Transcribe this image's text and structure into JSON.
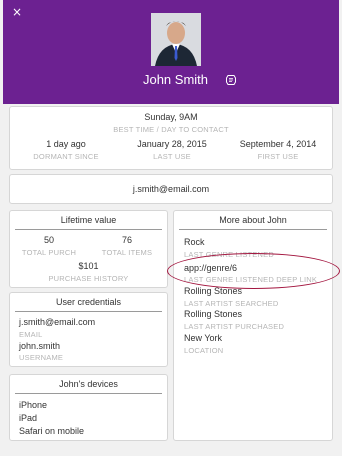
{
  "header": {
    "close_glyph": "×",
    "name": "John Smith",
    "bg_color": "#6c2191"
  },
  "contact": {
    "best_time_value": "Sunday, 9AM",
    "best_time_label": "BEST TIME / DAY TO CONTACT",
    "dormant_value": "1 day ago",
    "dormant_label": "DORMANT SINCE",
    "last_use_value": "January 28, 2015",
    "last_use_label": "LAST USE",
    "first_use_value": "September 4, 2014",
    "first_use_label": "FIRST USE"
  },
  "email_card": {
    "email": "j.smith@email.com"
  },
  "lifetime": {
    "title": "Lifetime value",
    "purch_value": "50",
    "purch_label": "TOTAL PURCH",
    "items_value": "76",
    "items_label": "TOTAL ITEMS",
    "history_value": "$101",
    "history_label": "PURCHASE HISTORY"
  },
  "credentials": {
    "title": "User credentials",
    "email_value": "j.smith@email.com",
    "email_label": "EMAIL",
    "username_value": "john.smith",
    "username_label": "USERNAME"
  },
  "devices": {
    "title": "John's  devices",
    "items": [
      "iPhone",
      "iPad",
      "Safari on mobile"
    ]
  },
  "more": {
    "title": "More about John",
    "fields": [
      {
        "value": "Rock",
        "label": "LAST GENRE  LISTENED"
      },
      {
        "value": "app://genre/6",
        "label": "LAST GENRE LISTENED  DEEP LINK"
      },
      {
        "value": "Rolling Stones",
        "label": "LAST ARTIST SEARCHED"
      },
      {
        "value": "Rolling Stones",
        "label": "LAST ARTIST PURCHASED"
      },
      {
        "value": "New York",
        "label": "LOCATION"
      }
    ]
  },
  "annotation": {
    "ring_color": "#a3163f"
  }
}
